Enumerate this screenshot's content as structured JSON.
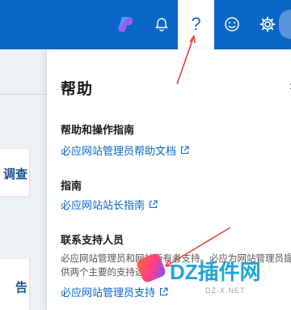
{
  "header": {
    "help_glyph": "?",
    "colors": {
      "bar": "#0a67c7",
      "active_tab": "#ffffff"
    }
  },
  "left": {
    "card_b_text": "调查",
    "card_c_text": "告"
  },
  "panel": {
    "title": "帮助",
    "close": "×",
    "sections": [
      {
        "title": "帮助和操作指南",
        "link": "必应网站管理员帮助文档"
      },
      {
        "title": "指南",
        "link": "必应网站站长指南"
      },
      {
        "title": "联系支持人员",
        "desc": "必应网站管理员和网站所有者支持。必应为网站管理员提供两个主要的支持选项。",
        "link": "必应网站管理员支持"
      }
    ]
  },
  "watermark": {
    "text": "DZ插件网",
    "url": "DZ-X.NET"
  },
  "icons": {
    "copilot": "copilot-icon",
    "bell": "bell-icon",
    "help": "question-icon",
    "smile": "smiley-icon",
    "gear": "gear-icon",
    "external": "external-link-icon"
  }
}
